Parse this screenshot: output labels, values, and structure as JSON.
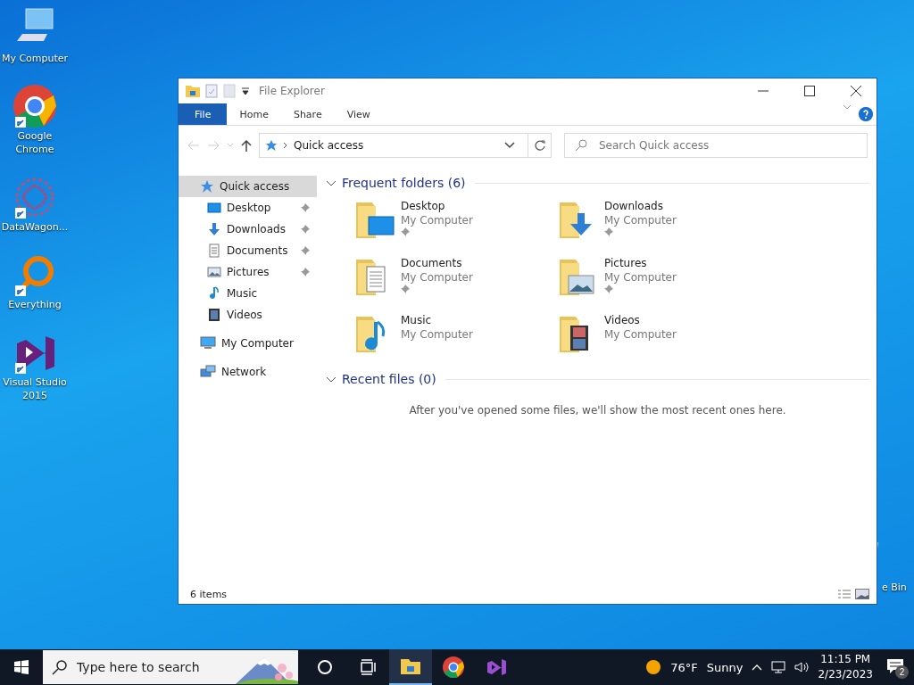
{
  "desktop": {
    "icons": [
      {
        "label": "My Computer",
        "kind": "computer",
        "shortcut": false
      },
      {
        "label": "Google Chrome",
        "kind": "chrome",
        "shortcut": true
      },
      {
        "label": "DataWagon...",
        "kind": "mandala",
        "shortcut": true
      },
      {
        "label": "Everything",
        "kind": "magnifier",
        "shortcut": true
      },
      {
        "label": "Visual Studio 2015",
        "kind": "vs",
        "shortcut": true
      }
    ],
    "recycle_bin": {
      "label": "e Bin"
    }
  },
  "window": {
    "title": "File Explorer",
    "ribbon_tabs": [
      {
        "label": "File",
        "kind": "file"
      },
      {
        "label": "Home",
        "kind": "tab"
      },
      {
        "label": "Share",
        "kind": "tab"
      },
      {
        "label": "View",
        "kind": "tab"
      }
    ],
    "address": {
      "path": "Quick access"
    },
    "search": {
      "placeholder": "Search Quick access"
    },
    "nav": [
      {
        "label": "Quick access",
        "kind": "star",
        "selected": true,
        "pinned": false,
        "children": [
          {
            "label": "Desktop",
            "kind": "desktop",
            "selected": false,
            "pinned": true
          },
          {
            "label": "Downloads",
            "kind": "download",
            "selected": false,
            "pinned": true
          },
          {
            "label": "Documents",
            "kind": "document",
            "selected": false,
            "pinned": true
          },
          {
            "label": "Pictures",
            "kind": "picture",
            "selected": false,
            "pinned": true
          },
          {
            "label": "Music",
            "kind": "music",
            "selected": false,
            "pinned": false
          },
          {
            "label": "Videos",
            "kind": "video",
            "selected": false,
            "pinned": false
          }
        ]
      },
      {
        "label": "My Computer",
        "kind": "computer",
        "selected": false,
        "pinned": false
      },
      {
        "label": "Network",
        "kind": "network",
        "selected": false,
        "pinned": false
      }
    ],
    "frequent": {
      "title": "Frequent folders (6)",
      "expanded": true,
      "folders": [
        {
          "name": "Desktop",
          "location": "My Computer",
          "kind": "desktop",
          "pinned": true
        },
        {
          "name": "Downloads",
          "location": "My Computer",
          "kind": "download",
          "pinned": true
        },
        {
          "name": "Documents",
          "location": "My Computer",
          "kind": "document",
          "pinned": true
        },
        {
          "name": "Pictures",
          "location": "My Computer",
          "kind": "picture",
          "pinned": true
        },
        {
          "name": "Music",
          "location": "My Computer",
          "kind": "music",
          "pinned": false
        },
        {
          "name": "Videos",
          "location": "My Computer",
          "kind": "video",
          "pinned": false
        }
      ]
    },
    "recent": {
      "title": "Recent files (0)",
      "expanded": true,
      "message": "After you've opened some files, we'll show the most recent ones here."
    },
    "status": "6 items"
  },
  "taskbar": {
    "search": {
      "placeholder": "Type here to search"
    },
    "apps": [
      {
        "kind": "cortana",
        "active": false
      },
      {
        "kind": "taskview",
        "active": false
      },
      {
        "kind": "explorer",
        "active": true
      },
      {
        "kind": "chrome",
        "active": false
      },
      {
        "kind": "vs",
        "active": false
      }
    ],
    "weather": {
      "temperature": "76°F",
      "condition": "Sunny"
    },
    "time": "11:15 PM",
    "date": "2/23/2023",
    "notifications": "2"
  }
}
